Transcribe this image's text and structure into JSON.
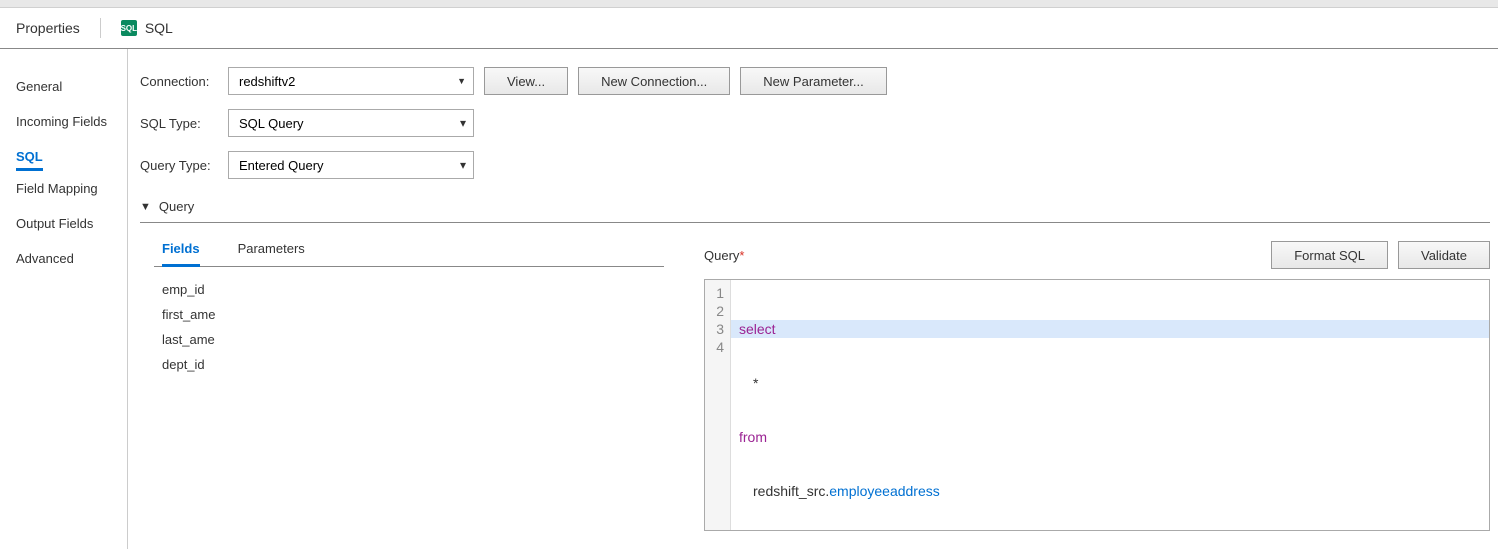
{
  "header": {
    "title": "Properties",
    "icon_text": "SQL",
    "sql_label": "SQL"
  },
  "sidebar": {
    "items": [
      {
        "label": "General",
        "active": false
      },
      {
        "label": "Incoming Fields",
        "active": false
      },
      {
        "label": "SQL",
        "active": true
      },
      {
        "label": "Field Mapping",
        "active": false
      },
      {
        "label": "Output Fields",
        "active": false
      },
      {
        "label": "Advanced",
        "active": false
      }
    ]
  },
  "form": {
    "connection_label": "Connection:",
    "connection_value": "redshiftv2",
    "view_btn": "View...",
    "new_connection_btn": "New Connection...",
    "new_parameter_btn": "New Parameter...",
    "sql_type_label": "SQL Type:",
    "sql_type_value": "SQL Query",
    "query_type_label": "Query Type:",
    "query_type_value": "Entered Query"
  },
  "query_section": {
    "title": "Query",
    "tabs": {
      "fields": "Fields",
      "parameters": "Parameters"
    },
    "fields": [
      "emp_id",
      "first_ame",
      "last_ame",
      "dept_id"
    ],
    "editor_label": "Query",
    "format_btn": "Format SQL",
    "validate_btn": "Validate",
    "code": {
      "line1": "select",
      "line2": "*",
      "line3": "from",
      "line4_schema": "redshift_src.",
      "line4_table": "employeeaddress"
    },
    "line_numbers": [
      "1",
      "2",
      "3",
      "4"
    ]
  }
}
